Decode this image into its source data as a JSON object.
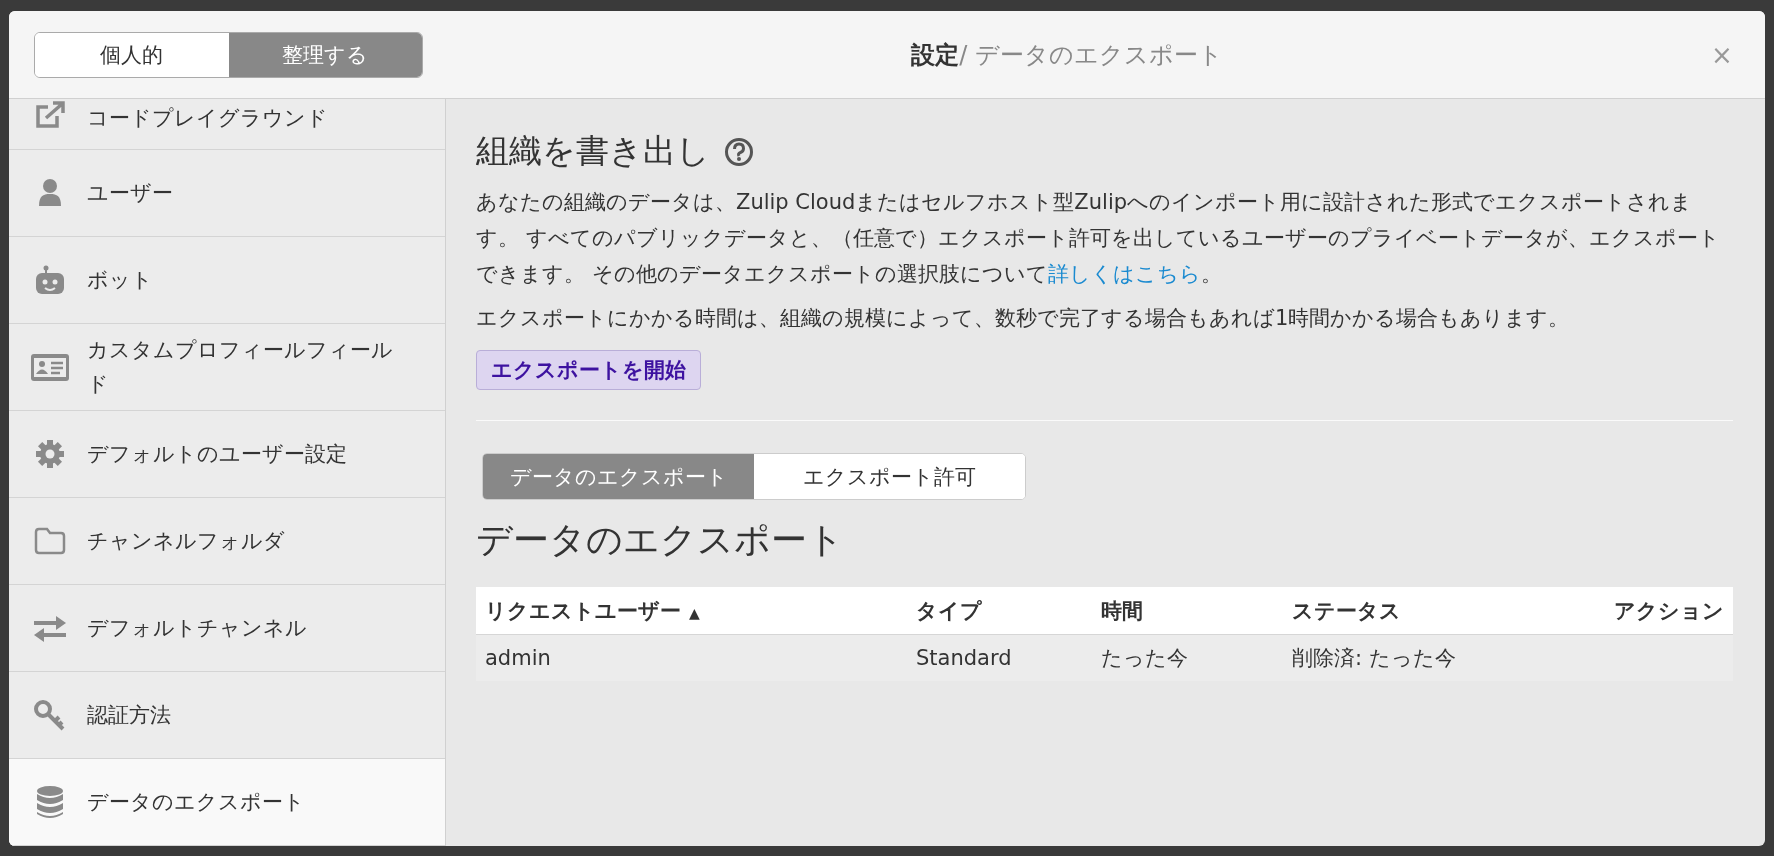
{
  "modal": {
    "toggle": [
      {
        "label": "個人的",
        "selected": false
      },
      {
        "label": "整理する",
        "selected": true
      }
    ],
    "title": {
      "section": "設定",
      "page": "/ データのエクスポート"
    },
    "close": "×"
  },
  "sidebar": {
    "items": [
      {
        "label": "コードプレイグラウンド",
        "selected": false
      },
      {
        "label": "ユーザー",
        "selected": false
      },
      {
        "label": "ボット",
        "selected": false
      },
      {
        "label": "カスタムプロフィールフィールド",
        "selected": false
      },
      {
        "label": "デフォルトのユーザー設定",
        "selected": false
      },
      {
        "label": "チャンネルフォルダ",
        "selected": false
      },
      {
        "label": "デフォルトチャンネル",
        "selected": false
      },
      {
        "label": "認証方法",
        "selected": false
      },
      {
        "label": "データのエクスポート",
        "selected": true
      }
    ]
  },
  "content": {
    "heading": "組織を書き出し",
    "description": {
      "text": "あなたの組織のデータは、Zulip Cloudまたはセルフホスト型Zulipへのインポート用に設計された形式でエクスポートされます。 すべてのパブリックデータと、（任意で）エクスポート許可を出しているユーザーのプライベートデータが、エクスポートできます。 その他のデータエクスポートの選択肢について",
      "link": "詳しくはこちら",
      "after": "。"
    },
    "note": "エクスポートにかかる時間は、組織の規模によって、数秒で完了する場合もあれば1時間かかる場合もあります。",
    "start_button": "エクスポートを開始",
    "tabs": [
      {
        "label": "データのエクスポート",
        "selected": true
      },
      {
        "label": "エクスポート許可",
        "selected": false
      }
    ],
    "table_heading": "データのエクスポート",
    "table": {
      "columns": [
        {
          "label": "リクエストユーザー",
          "sort_indicator": "▲"
        },
        {
          "label": "タイプ"
        },
        {
          "label": "時間"
        },
        {
          "label": "ステータス"
        },
        {
          "label": "アクション"
        }
      ],
      "rows": [
        [
          "admin",
          "Standard",
          "たった今",
          "削除済: たった今",
          ""
        ]
      ]
    }
  }
}
